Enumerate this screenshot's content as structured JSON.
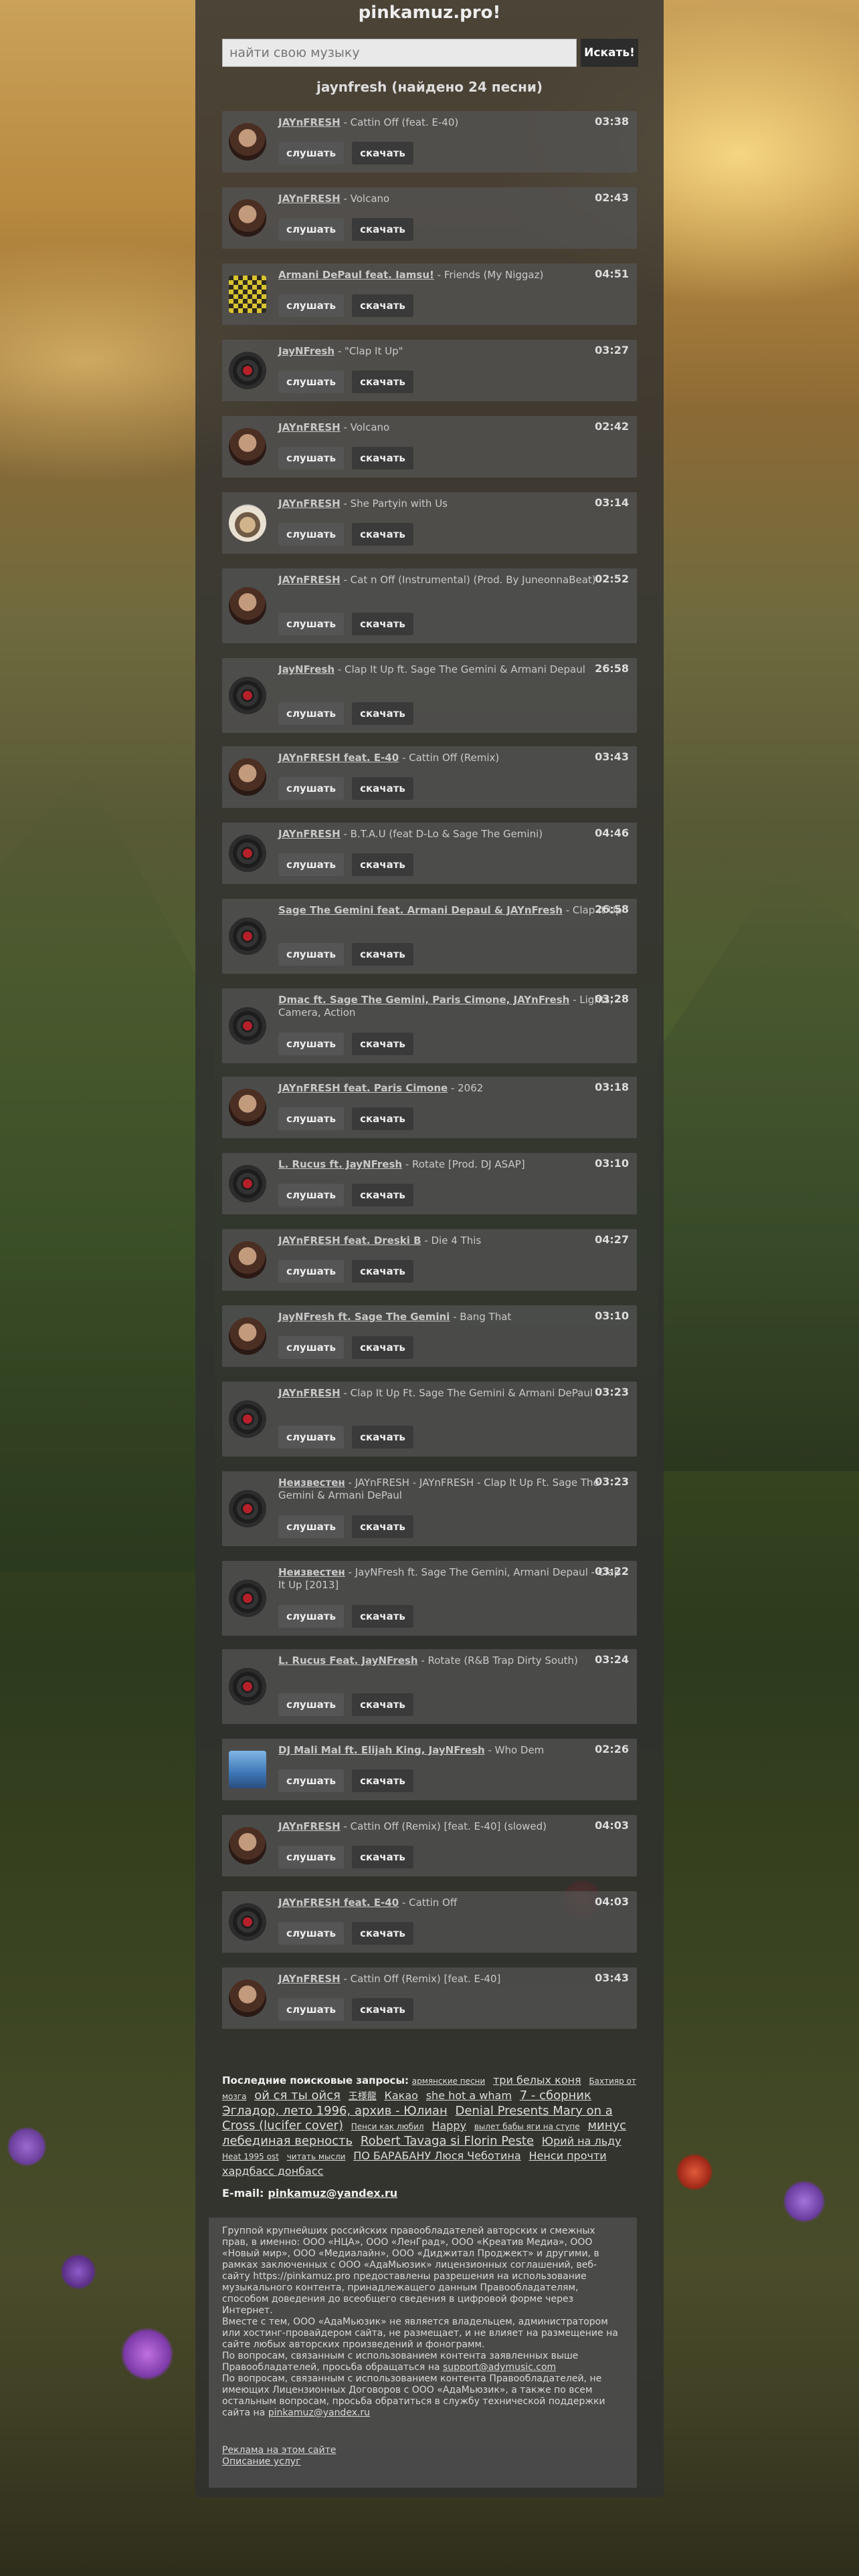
{
  "site": {
    "title": "pinkamuz.pro!"
  },
  "search": {
    "placeholder": "найти свою музыку",
    "button_label": "Искать!"
  },
  "results_heading": "jaynfresh (найдено 24 песни)",
  "buttons": {
    "listen": "слушать",
    "download": "скачать"
  },
  "songs": [
    {
      "artist": "JAYnFRESH",
      "title": " - Cattin Off (feat. E-40)",
      "duration": "03:38",
      "icon": "face"
    },
    {
      "artist": "JAYnFRESH",
      "title": " - Volcano",
      "duration": "02:43",
      "icon": "face"
    },
    {
      "artist": "Armani DePaul feat. Iamsu!",
      "title": " - Friends (My Niggaz)",
      "duration": "04:51",
      "icon": "pattern"
    },
    {
      "artist": "JayNFresh",
      "title": " - \"Clap It Up\"",
      "duration": "03:27",
      "icon": "vinyl"
    },
    {
      "artist": "JAYnFRESH",
      "title": " - Volcano",
      "duration": "02:42",
      "icon": "face"
    },
    {
      "artist": "JAYnFRESH",
      "title": " - She Partyin with Us",
      "duration": "03:14",
      "icon": "dog"
    },
    {
      "artist": "JAYnFRESH",
      "title": " - Cat n Off (Instrumental) (Prod. By JuneonnaBeat)",
      "duration": "02:52",
      "icon": "face"
    },
    {
      "artist": "JayNFresh",
      "title": " - Clap It Up ft. Sage The Gemini & Armani Depaul",
      "duration": "26:58",
      "icon": "vinyl"
    },
    {
      "artist": "JAYnFRESH feat. E-40",
      "title": " - Cattin Off (Remix)",
      "duration": "03:43",
      "icon": "face"
    },
    {
      "artist": "JAYnFRESH",
      "title": " - B.T.A.U (feat D-Lo & Sage The Gemini)",
      "duration": "04:46",
      "icon": "vinyl"
    },
    {
      "artist": "Sage The Gemini feat. Armani Depaul & JAYnFresh",
      "title": " - Clap It Up",
      "duration": "26:58",
      "icon": "vinyl"
    },
    {
      "artist": "Dmac ft. Sage The Gemini, Paris Cimone, JAYnFresh",
      "title": " - Lights, Camera, Action",
      "duration": "03:28",
      "icon": "vinyl"
    },
    {
      "artist": "JAYnFRESH feat. Paris Cimone",
      "title": " - 2062",
      "duration": "03:18",
      "icon": "face"
    },
    {
      "artist": "L. Rucus ft. JayNFresh",
      "title": " - Rotate [Prod. DJ ASAP]",
      "duration": "03:10",
      "icon": "vinyl"
    },
    {
      "artist": "JAYnFRESH feat. Dreski B",
      "title": " - Die 4 This",
      "duration": "04:27",
      "icon": "face"
    },
    {
      "artist": "JayNFresh ft. Sage The Gemini",
      "title": " - Bang That",
      "duration": "03:10",
      "icon": "face"
    },
    {
      "artist": "JAYnFRESH",
      "title": " - Clap It Up Ft. Sage The Gemini & Armani DePaul",
      "duration": "03:23",
      "icon": "vinyl"
    },
    {
      "artist": "Неизвестен",
      "title": " - JAYnFRESH - JAYnFRESH - Clap It Up Ft. Sage The Gemini & Armani DePaul",
      "duration": "03:23",
      "icon": "vinyl"
    },
    {
      "artist": "Неизвестен",
      "title": " - JayNFresh ft. Sage The Gemini, Armani Depaul - Clap It Up [2013]",
      "duration": "03:22",
      "icon": "vinyl"
    },
    {
      "artist": "L. Rucus Feat. JayNFresh",
      "title": " - Rotate (R&B Trap Dirty South)",
      "duration": "03:24",
      "icon": "vinyl"
    },
    {
      "artist": "DJ Mali Mal ft. Elijah King, JayNFresh",
      "title": " - Who Dem",
      "duration": "02:26",
      "icon": "sky"
    },
    {
      "artist": "JAYnFRESH",
      "title": " - Cattin Off (Remix) [feat. E-40] (slowed)",
      "duration": "04:03",
      "icon": "face"
    },
    {
      "artist": "JAYnFRESH feat. E-40",
      "title": " - Cattin Off",
      "duration": "04:03",
      "icon": "vinyl"
    },
    {
      "artist": "JAYnFRESH",
      "title": " - Cattin Off (Remix) [feat. E-40]",
      "duration": "03:43",
      "icon": "face"
    }
  ],
  "recent": {
    "label": "Последние поисковые запросы:",
    "queries": [
      "армянские песни",
      "три белых коня",
      "Бахтияр от мозга",
      "ой ся ты ойся",
      "王様龍",
      "Какао",
      "she hot a wham",
      "7 - сборник",
      "Эгладор, лето 1996, архив - Юлиан",
      "Denial Presents Mary on a Cross (lucifer cover)",
      "Пенси как любил",
      "Happy",
      "вылет бабы яги на ступе",
      "минус лебединая верность",
      "Robert Tavaga si Florin Peste",
      "Юрий на льду",
      "Heat 1995 ost",
      "читать мысли",
      "ПО БАРАБАНУ Люся Чеботина",
      "Ненси прочти",
      "хардбасс донбасс"
    ]
  },
  "email": {
    "label": "E-mail:",
    "address": "pinkamuz@yandex.ru"
  },
  "legal": {
    "p1": "Группой крупнейших российских правообладателей авторских и смежных прав, в именно: ООО «НЦА», ООО «ЛенГрад», ООО «Креатив Медиа», ООО «Новый мир», ООО «Медиалайн», ООО «Диджитал Проджект» и другими, в рамках заключенных с ООО «АдаМьюзик» лицензионных соглашений, веб-сайту https://pinkamuz.pro предоставлены разрешения на использование музыкального контента, принадлежащего данным Правообладателям, способом доведения до всеобщего сведения в цифровой форме через Интернет.",
    "p2": "Вместе с тем, ООО «АдаМьюзик» не является владельцем, администратором или хостинг-провайдером сайта, не размещает, и не влияет на размещение на сайте любых авторских произведений и фонограмм.",
    "p3_pre": "По вопросам, связанным с использованием контента заявленных выше Правообладателей, просьба обращаться на ",
    "p3_link": "support@adymusic.com",
    "p4_pre": "По вопросам, связанным с использованием контента Правообладателей, не имеющих Лицензионных Договоров с ООО «АдаМьюзик», а также по всем остальным вопросам, просьба обратиться в службу технической поддержки сайта на ",
    "p4_link": "pinkamuz@yandex.ru",
    "ads_link": "Реклама на этом сайте",
    "services_link": "Описание услуг"
  },
  "colors": {
    "panel": "#303030",
    "song_bg": "#555555",
    "accent_text": "#c9c9c9"
  }
}
